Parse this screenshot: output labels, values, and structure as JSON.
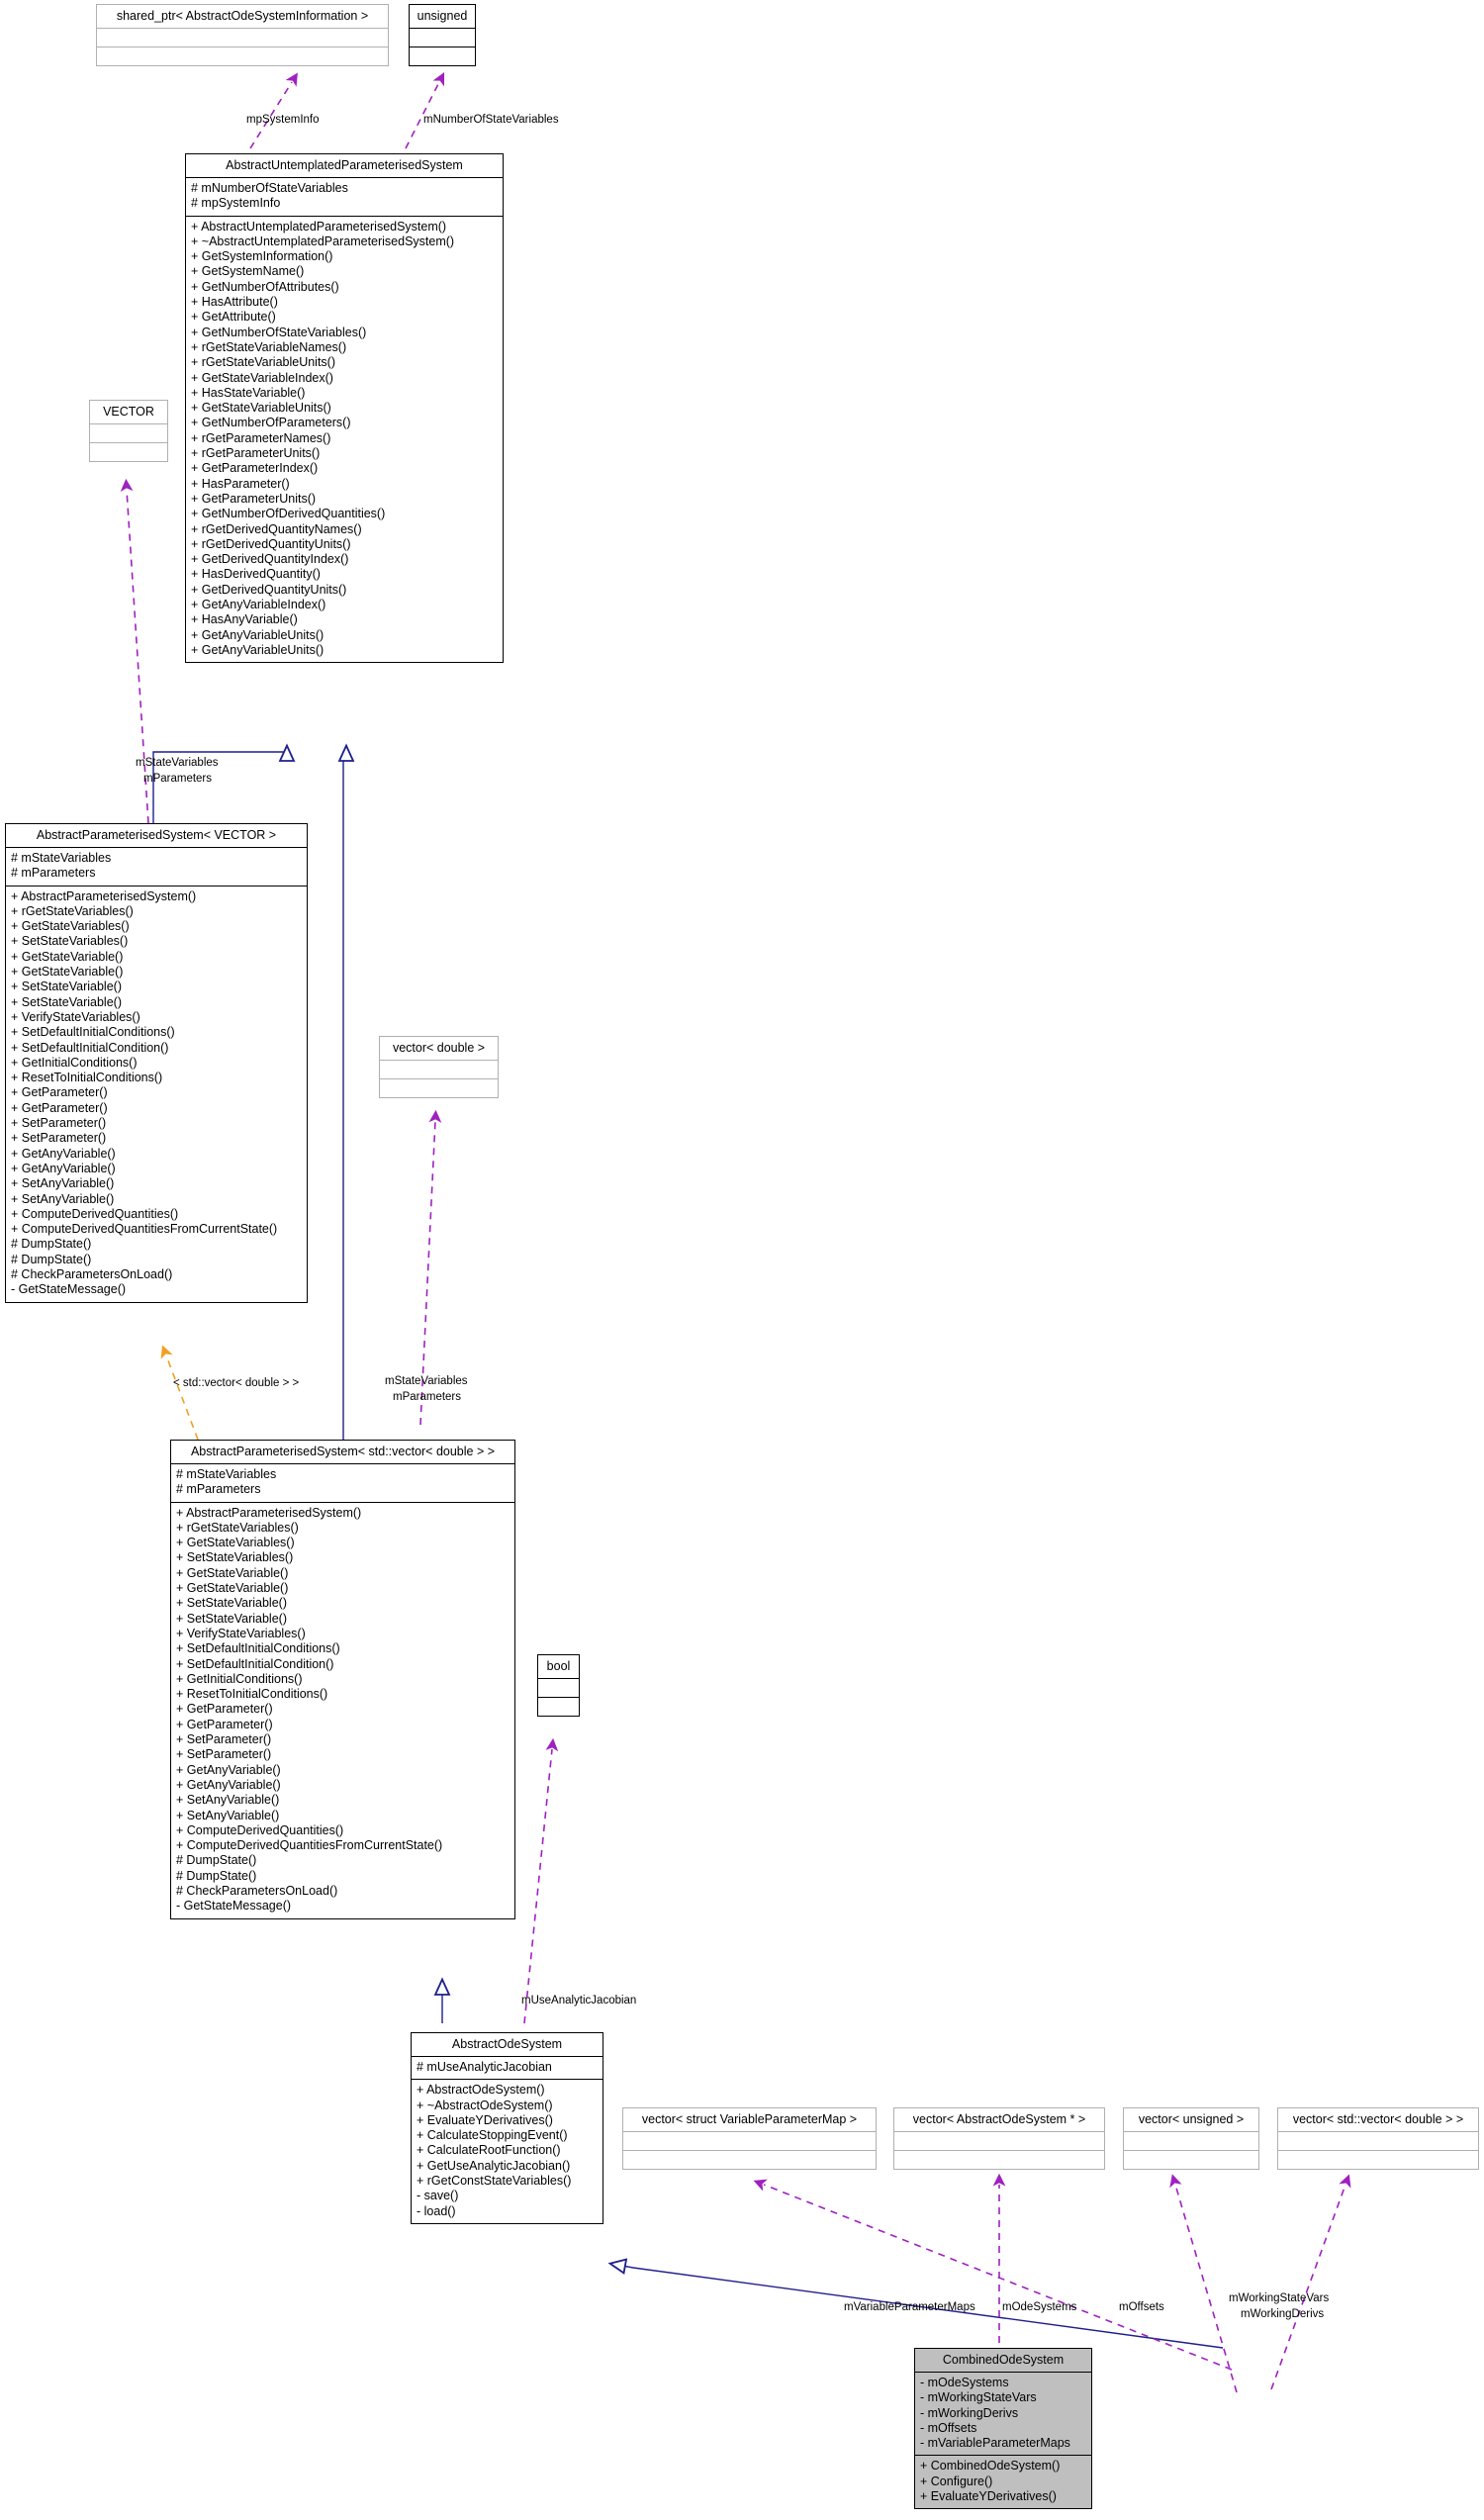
{
  "diagram": {
    "kind": "uml-class-diagram",
    "colors": {
      "inheritance_edge": "#1f1f8c",
      "usage_edge": "#a020c0",
      "template_edge": "#f0a020",
      "node_border": "#000000",
      "node_border_light": "#b0b0b0",
      "node_fill": "#ffffff",
      "node_fill_highlight": "#bfbfbf",
      "text": "#000000"
    },
    "nodes": [
      {
        "id": "shared_ptr",
        "title": "shared_ptr< AbstractOdeSystemInformation >",
        "attributes": [],
        "methods": [],
        "style": "light"
      },
      {
        "id": "unsigned",
        "title": "unsigned",
        "attributes": [],
        "methods": [],
        "style": "solid"
      },
      {
        "id": "aups",
        "title": "AbstractUntemplatedParameterisedSystem",
        "attributes": [
          "# mNumberOfStateVariables",
          "# mpSystemInfo"
        ],
        "methods": [
          "+ AbstractUntemplatedParameterisedSystem()",
          "+ ~AbstractUntemplatedParameterisedSystem()",
          "+ GetSystemInformation()",
          "+ GetSystemName()",
          "+ GetNumberOfAttributes()",
          "+ HasAttribute()",
          "+ GetAttribute()",
          "+ GetNumberOfStateVariables()",
          "+ rGetStateVariableNames()",
          "+ rGetStateVariableUnits()",
          "+ GetStateVariableIndex()",
          "+ HasStateVariable()",
          "+ GetStateVariableUnits()",
          "+ GetNumberOfParameters()",
          "+ rGetParameterNames()",
          "+ rGetParameterUnits()",
          "+ GetParameterIndex()",
          "+ HasParameter()",
          "+ GetParameterUnits()",
          "+ GetNumberOfDerivedQuantities()",
          "+ rGetDerivedQuantityNames()",
          "+ rGetDerivedQuantityUnits()",
          "+ GetDerivedQuantityIndex()",
          "+ HasDerivedQuantity()",
          "+ GetDerivedQuantityUnits()",
          "+ GetAnyVariableIndex()",
          "+ HasAnyVariable()",
          "+ GetAnyVariableUnits()",
          "+ GetAnyVariableUnits()"
        ],
        "style": "solid"
      },
      {
        "id": "vector_caps",
        "title": "VECTOR",
        "attributes": [],
        "methods": [],
        "style": "light"
      },
      {
        "id": "aps_vector",
        "title": "AbstractParameterisedSystem< VECTOR >",
        "attributes": [
          "# mStateVariables",
          "# mParameters"
        ],
        "methods": [
          "+ AbstractParameterisedSystem()",
          "+ rGetStateVariables()",
          "+ GetStateVariables()",
          "+ SetStateVariables()",
          "+ GetStateVariable()",
          "+ GetStateVariable()",
          "+ SetStateVariable()",
          "+ SetStateVariable()",
          "+ VerifyStateVariables()",
          "+ SetDefaultInitialConditions()",
          "+ SetDefaultInitialCondition()",
          "+ GetInitialConditions()",
          "+ ResetToInitialConditions()",
          "+ GetParameter()",
          "+ GetParameter()",
          "+ SetParameter()",
          "+ SetParameter()",
          "+ GetAnyVariable()",
          "+ GetAnyVariable()",
          "+ SetAnyVariable()",
          "+ SetAnyVariable()",
          "+ ComputeDerivedQuantities()",
          "+ ComputeDerivedQuantitiesFromCurrentState()",
          "# DumpState()",
          "# DumpState()",
          "# CheckParametersOnLoad()",
          "- GetStateMessage()"
        ],
        "style": "solid"
      },
      {
        "id": "vector_double",
        "title": "vector< double >",
        "attributes": [],
        "methods": [],
        "style": "light"
      },
      {
        "id": "aps_stdvector",
        "title": "AbstractParameterisedSystem< std::vector< double > >",
        "attributes": [
          "# mStateVariables",
          "# mParameters"
        ],
        "methods": [
          "+ AbstractParameterisedSystem()",
          "+ rGetStateVariables()",
          "+ GetStateVariables()",
          "+ SetStateVariables()",
          "+ GetStateVariable()",
          "+ GetStateVariable()",
          "+ SetStateVariable()",
          "+ SetStateVariable()",
          "+ VerifyStateVariables()",
          "+ SetDefaultInitialConditions()",
          "+ SetDefaultInitialCondition()",
          "+ GetInitialConditions()",
          "+ ResetToInitialConditions()",
          "+ GetParameter()",
          "+ GetParameter()",
          "+ SetParameter()",
          "+ SetParameter()",
          "+ GetAnyVariable()",
          "+ GetAnyVariable()",
          "+ SetAnyVariable()",
          "+ SetAnyVariable()",
          "+ ComputeDerivedQuantities()",
          "+ ComputeDerivedQuantitiesFromCurrentState()",
          "# DumpState()",
          "# DumpState()",
          "# CheckParametersOnLoad()",
          "- GetStateMessage()"
        ],
        "style": "solid"
      },
      {
        "id": "bool",
        "title": "bool",
        "attributes": [],
        "methods": [],
        "style": "solid"
      },
      {
        "id": "aos",
        "title": "AbstractOdeSystem",
        "attributes": [
          "# mUseAnalyticJacobian"
        ],
        "methods": [
          "+ AbstractOdeSystem()",
          "+ ~AbstractOdeSystem()",
          "+ EvaluateYDerivatives()",
          "+ CalculateStoppingEvent()",
          "+ CalculateRootFunction()",
          "+ GetUseAnalyticJacobian()",
          "+ rGetConstStateVariables()",
          "- save()",
          "- load()"
        ],
        "style": "solid"
      },
      {
        "id": "vec_vpm",
        "title": "vector< struct VariableParameterMap >",
        "attributes": [],
        "methods": [],
        "style": "light"
      },
      {
        "id": "vec_aos_ptr",
        "title": "vector< AbstractOdeSystem * >",
        "attributes": [],
        "methods": [],
        "style": "light"
      },
      {
        "id": "vec_unsigned",
        "title": "vector< unsigned >",
        "attributes": [],
        "methods": [],
        "style": "light"
      },
      {
        "id": "vec_vec_double",
        "title": "vector< std::vector< double > >",
        "attributes": [],
        "methods": [],
        "style": "light"
      },
      {
        "id": "combined",
        "title": "CombinedOdeSystem",
        "attributes": [
          "- mOdeSystems",
          "- mWorkingStateVars",
          "- mWorkingDerivs",
          "- mOffsets",
          "- mVariableParameterMaps"
        ],
        "methods": [
          "+ CombinedOdeSystem()",
          "+ Configure()",
          "+ EvaluateYDerivatives()"
        ],
        "style": "highlight"
      }
    ],
    "edge_labels": [
      {
        "id": "lbl_mpSystemInfo",
        "text": "mpSystemInfo"
      },
      {
        "id": "lbl_mNumberOfStateVariables",
        "text": "mNumberOfStateVariables"
      },
      {
        "id": "lbl_mStateVariables_mParameters_left_1",
        "text": "mStateVariables"
      },
      {
        "id": "lbl_mStateVariables_mParameters_left_2",
        "text": "mParameters"
      },
      {
        "id": "lbl_template_stdvector",
        "text": "< std::vector< double > >"
      },
      {
        "id": "lbl_mStateVariables_mParameters_mid_1",
        "text": "mStateVariables"
      },
      {
        "id": "lbl_mStateVariables_mParameters_mid_2",
        "text": "mParameters"
      },
      {
        "id": "lbl_mUseAnalyticJacobian",
        "text": "mUseAnalyticJacobian"
      },
      {
        "id": "lbl_mVariableParameterMaps",
        "text": "mVariableParameterMaps"
      },
      {
        "id": "lbl_mOdeSystems",
        "text": "mOdeSystems"
      },
      {
        "id": "lbl_mOffsets",
        "text": "mOffsets"
      },
      {
        "id": "lbl_mWorkingStateVars",
        "text": "mWorkingStateVars"
      },
      {
        "id": "lbl_mWorkingDerivs",
        "text": "mWorkingDerivs"
      }
    ]
  }
}
